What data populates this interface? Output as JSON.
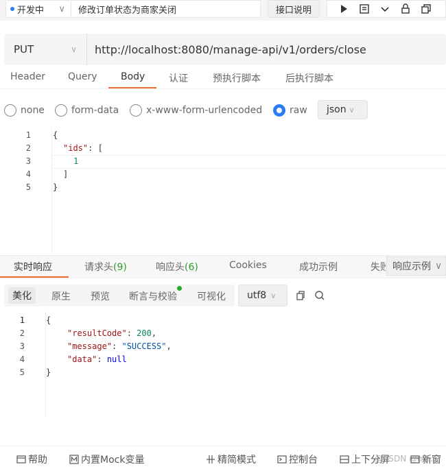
{
  "top": {
    "env_label": "开发中",
    "env_dot_color": "#2d7cf6",
    "api_name": "修改订单状态为商家关闭",
    "doc_button": "接口说明",
    "tool_icons": [
      "play-icon",
      "save-icon",
      "chevron-down-icon",
      "share-icon",
      "copy-icon"
    ]
  },
  "request": {
    "method": "PUT",
    "url": "http://localhost:8080/manage-api/v1/orders/close",
    "tabs": [
      "Header",
      "Query",
      "Body",
      "认证",
      "预执行脚本",
      "后执行脚本"
    ],
    "active_tab": "Body",
    "body_types": [
      "none",
      "form-data",
      "x-www-form-urlencoded",
      "raw"
    ],
    "active_body_type": "raw",
    "format": "json",
    "body_lines": [
      "1",
      "2",
      "3",
      "4",
      "5"
    ],
    "body_code": {
      "l1": "{",
      "l2_key": "\"ids\"",
      "l2_rest": ": [",
      "l3": "1",
      "l4": "]",
      "l5": "}"
    }
  },
  "response": {
    "tabs": [
      "实时响应",
      "请求头",
      "响应头",
      "Cookies",
      "成功示例",
      "失败"
    ],
    "req_header_count": "(9)",
    "resp_header_count": "(6)",
    "active_tab": "实时响应",
    "example_select": "响应示例",
    "view_modes": [
      "美化",
      "原生",
      "预览",
      "断言与校验",
      "可视化"
    ],
    "active_view": "美化",
    "encoding": "utf8",
    "lines": [
      "1",
      "2",
      "3",
      "4",
      "5"
    ],
    "code": {
      "l1": "{",
      "k1": "\"resultCode\"",
      "v1": "200",
      "k2": "\"message\"",
      "v2": "\"SUCCESS\"",
      "k3": "\"data\"",
      "v3": "null",
      "l5": "}"
    }
  },
  "footer": {
    "help": "帮助",
    "mock": "内置Mock变量",
    "simple": "精简模式",
    "console": "控制台",
    "split": "上下分屏",
    "newwin": "新窗",
    "watermark": "@CSDN @mr..."
  },
  "colors": {
    "accent": "#f06c2a",
    "primary": "#2d7cf6",
    "success": "#2aa82a"
  }
}
